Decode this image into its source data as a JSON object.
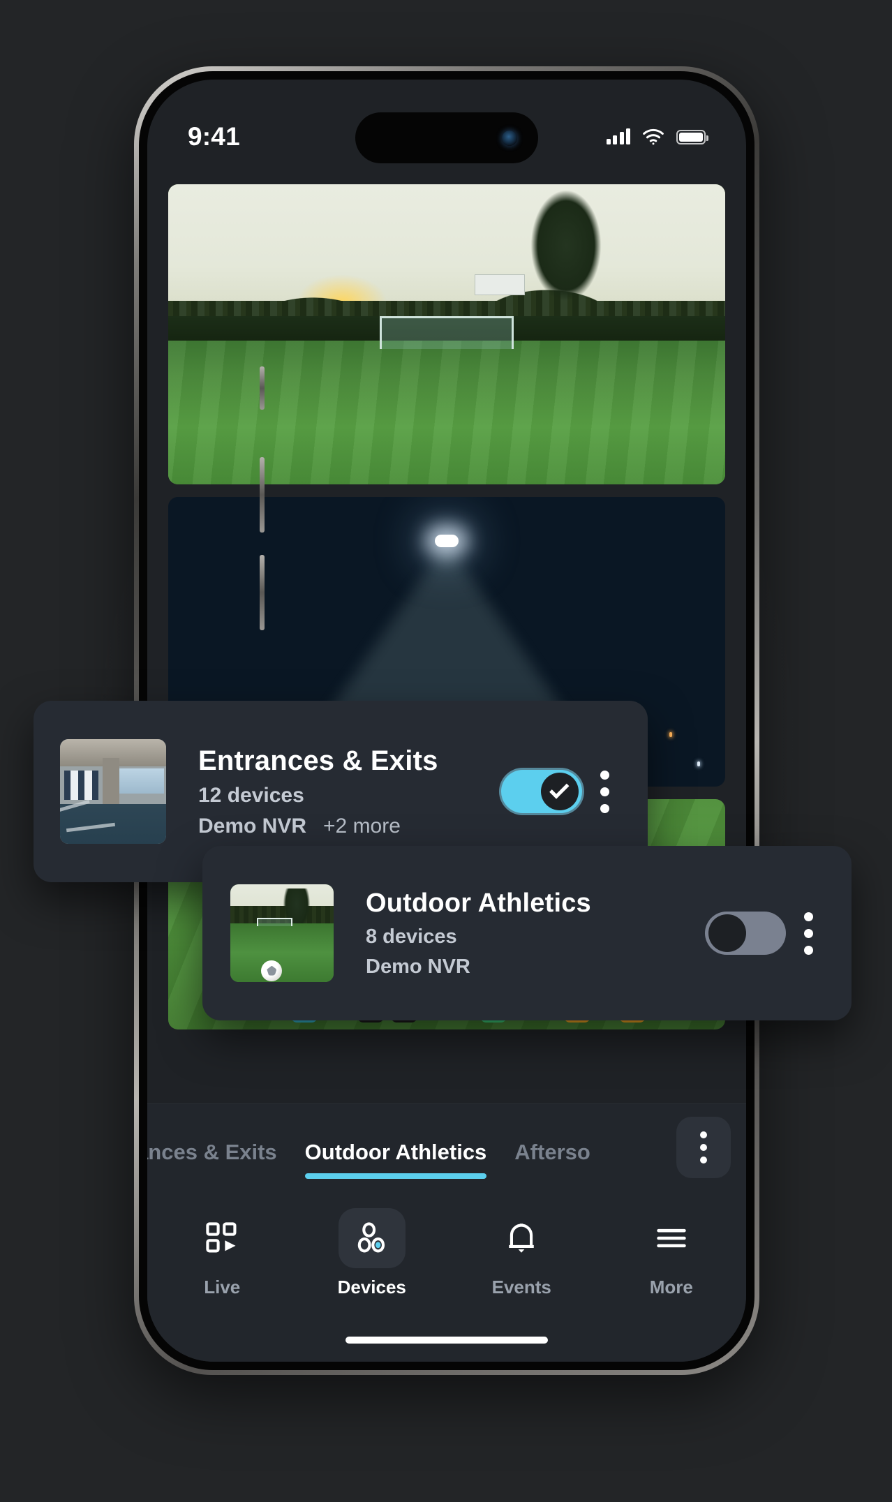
{
  "status_bar": {
    "time": "9:41",
    "cellular_icon": "cellular-signal-icon",
    "wifi_icon": "wifi-icon",
    "battery_icon": "battery-full-icon"
  },
  "feed": {
    "tiles": [
      {
        "name": "soccer-field-sunset-thumbnail",
        "scene": "Soccer goal on green field at sunset"
      },
      {
        "name": "night-floodlight-thumbnail",
        "scene": "Stadium floodlight beam at night"
      },
      {
        "name": "soccer-players-thumbnail",
        "scene": "Players legs with soccer ball on pitch"
      }
    ]
  },
  "overlay_cards": [
    {
      "title": "Entrances & Exits",
      "devices": "12 devices",
      "nvr": "Demo NVR",
      "more": "+2 more",
      "toggle_state": "on",
      "toggle_icon": "check-icon",
      "menu_icon": "kebab-menu-icon",
      "thumbnail": "parking-garage-thumbnail"
    },
    {
      "title": "Outdoor Athletics",
      "devices": "8 devices",
      "nvr": "Demo NVR",
      "more": "",
      "toggle_state": "off",
      "toggle_icon": "",
      "menu_icon": "kebab-menu-icon",
      "thumbnail": "soccer-field-thumbnail"
    }
  ],
  "tab_bar": {
    "tabs": [
      {
        "label": "rances & Exits",
        "active": false
      },
      {
        "label": "Outdoor Athletics",
        "active": true
      },
      {
        "label": "Afterso",
        "active": false
      }
    ],
    "overflow_icon": "kebab-menu-icon"
  },
  "bottom_nav": {
    "items": [
      {
        "label": "Live",
        "icon": "live-grid-play-icon",
        "active": false
      },
      {
        "label": "Devices",
        "icon": "devices-circles-icon",
        "active": true
      },
      {
        "label": "Events",
        "icon": "bell-icon",
        "active": false
      },
      {
        "label": "More",
        "icon": "hamburger-menu-icon",
        "active": false
      }
    ]
  },
  "colors": {
    "accent": "#5ccfee",
    "surface": "#262b33",
    "nav_surface": "#22262c",
    "screen_bg": "#1f2226",
    "page_bg": "#232527",
    "toggle_off": "#7a8190",
    "muted_text": "#7a828e"
  }
}
